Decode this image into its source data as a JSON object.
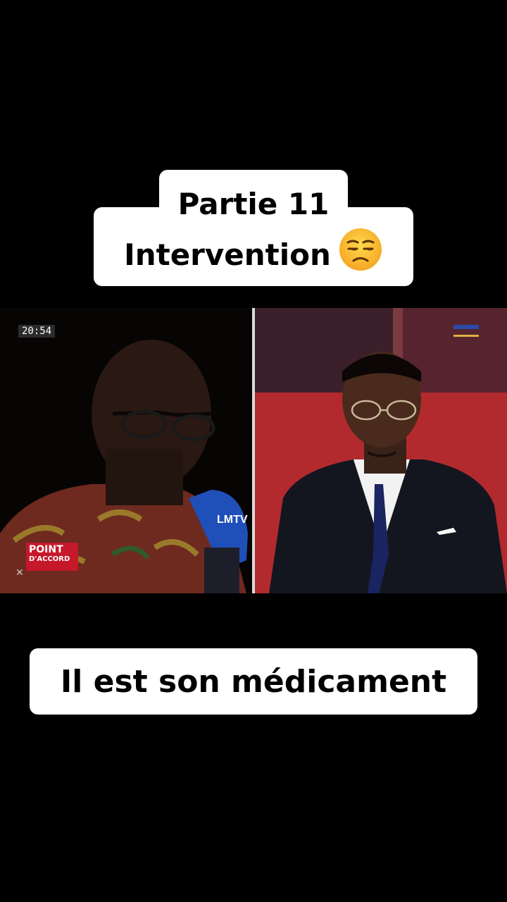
{
  "header": {
    "line1": "Partie 11",
    "line2": "Intervention"
  },
  "video": {
    "timestamp": "20:54",
    "channel_logo_line1": "POINT",
    "channel_logo_line2": "D'ACCORD",
    "mic_logo_text": "LMTV"
  },
  "caption": {
    "text": "Il est son médicament"
  },
  "colors": {
    "background": "#000000",
    "caption_bg": "#ffffff",
    "logo_red": "#c5182a"
  }
}
